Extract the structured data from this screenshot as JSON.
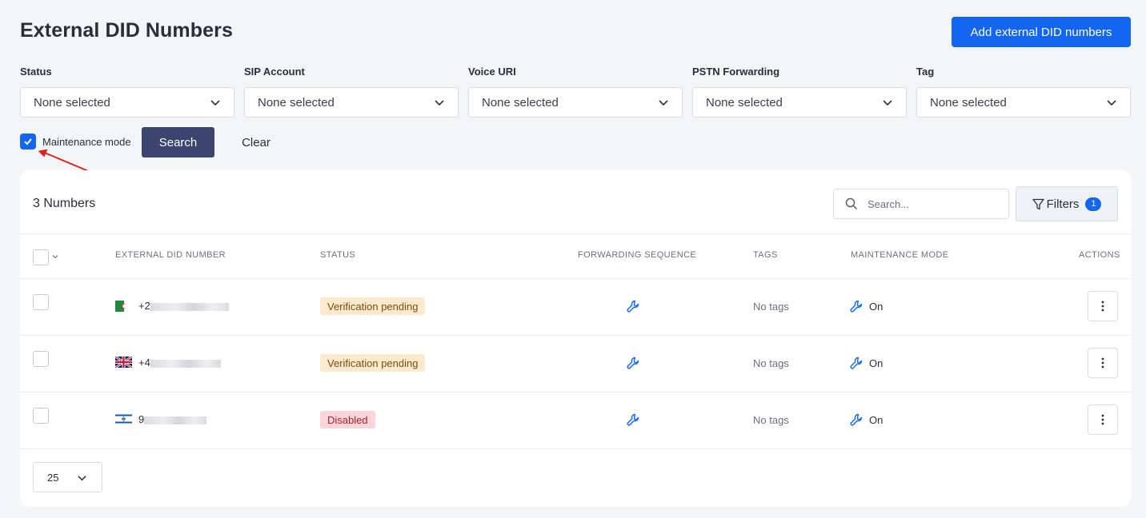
{
  "header": {
    "title": "External DID Numbers",
    "add_button": "Add external DID numbers"
  },
  "filters": [
    {
      "label": "Status",
      "value": "None selected"
    },
    {
      "label": "SIP Account",
      "value": "None selected"
    },
    {
      "label": "Voice URI",
      "value": "None selected"
    },
    {
      "label": "PSTN Forwarding",
      "value": "None selected"
    },
    {
      "label": "Tag",
      "value": "None selected"
    }
  ],
  "maintenance": {
    "label": "Maintenance mode",
    "checked": true
  },
  "actions": {
    "search": "Search",
    "clear": "Clear"
  },
  "table": {
    "count_label": "3 Numbers",
    "search_placeholder": "Search...",
    "filters_button": "Filters",
    "filters_count": "1",
    "columns": [
      "EXTERNAL DID NUMBER",
      "STATUS",
      "FORWARDING SEQUENCE",
      "TAGS",
      "MAINTENANCE MODE",
      "ACTIONS"
    ],
    "rows": [
      {
        "country": "Algeria",
        "number_prefix": "+2",
        "status": "Verification pending",
        "status_type": "pending",
        "tags": "No tags",
        "maintenance": "On"
      },
      {
        "country": "United Kingdom",
        "number_prefix": "+4",
        "status": "Verification pending",
        "status_type": "pending",
        "tags": "No tags",
        "maintenance": "On"
      },
      {
        "country": "Israel",
        "number_prefix": "9",
        "status": "Disabled",
        "status_type": "disabled",
        "tags": "No tags",
        "maintenance": "On"
      }
    ],
    "per_page": "25"
  },
  "colors": {
    "primary": "#1266f1",
    "search_button": "#3b4570",
    "pending_bg": "#fde9cd",
    "disabled_bg": "#fbd5da",
    "annotation_arrow": "#e0201b"
  },
  "icons": [
    "chevron-down-icon",
    "check-icon",
    "search-icon",
    "funnel-icon",
    "wrench-icon",
    "kebab-icon"
  ]
}
